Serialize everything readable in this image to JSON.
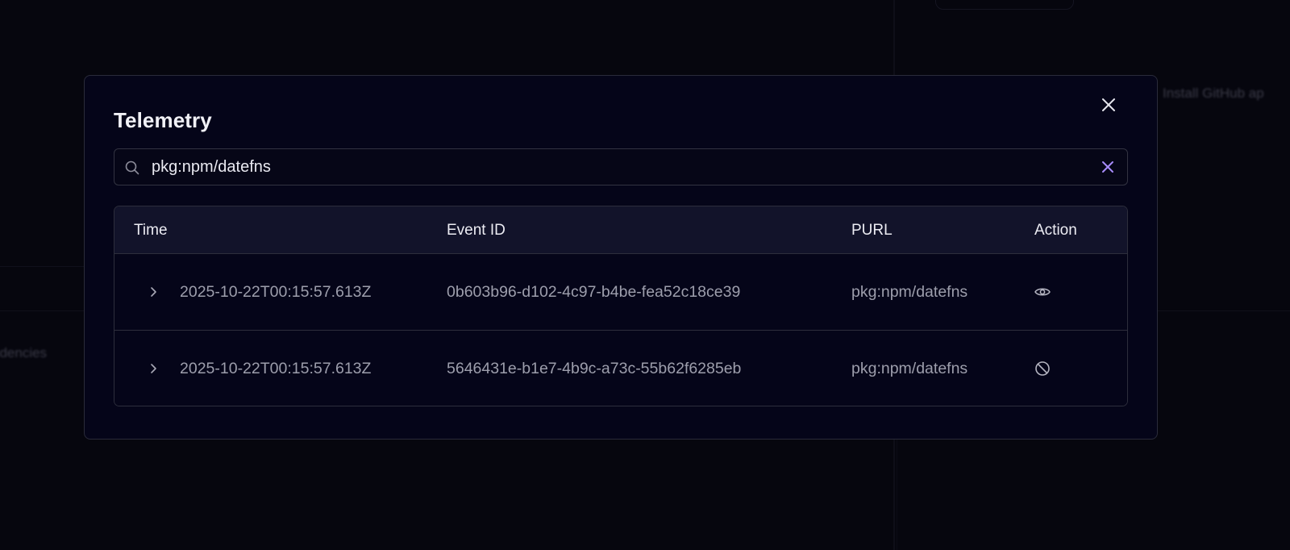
{
  "modal": {
    "title": "Telemetry",
    "close_icon": "close-icon"
  },
  "search": {
    "value": "pkg:npm/datefns",
    "icon": "search-icon",
    "clear_icon": "clear-icon",
    "clear_color": "#a78bfa"
  },
  "table": {
    "columns": [
      "Time",
      "Event ID",
      "PURL",
      "Action"
    ],
    "rows": [
      {
        "time": "2025-10-22T00:15:57.613Z",
        "event_id": "0b603b96-d102-4c97-b4be-fea52c18ce39",
        "purl": "pkg:npm/datefns",
        "action_icon": "eye-icon"
      },
      {
        "time": "2025-10-22T00:15:57.613Z",
        "event_id": "5646431e-b1e7-4b9c-a73c-55b62f6285eb",
        "purl": "pkg:npm/datefns",
        "action_icon": "ban-icon"
      }
    ]
  },
  "colors": {
    "background": "#06060e",
    "modal_background": "#050519",
    "header_background": "#12132a",
    "accent": "#a78bfa"
  }
}
